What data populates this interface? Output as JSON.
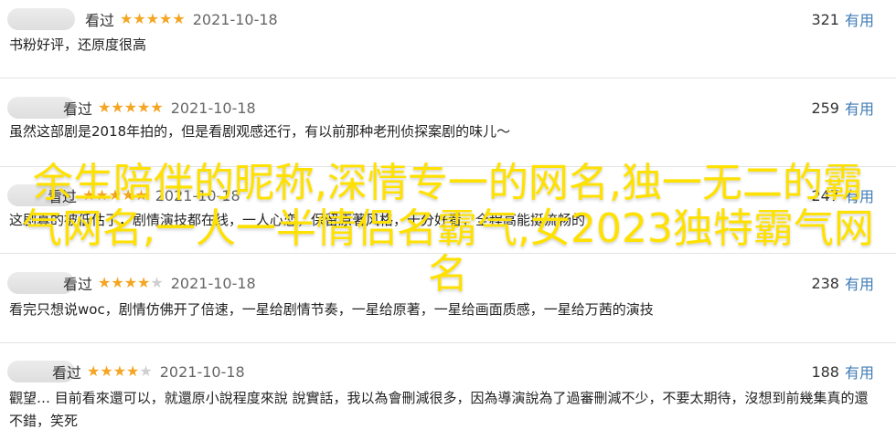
{
  "reviews": [
    {
      "status": "看过",
      "rating": 5,
      "date": "2021-10-18",
      "count": "321",
      "useful": "有用",
      "comment": "书粉好评，还原度很高"
    },
    {
      "status": "看过",
      "rating": 5,
      "date": "2021-10-18",
      "count": "259",
      "useful": "有用",
      "comment": "虽然这部剧是2018年拍的，但是看剧观感还行，有以前那种老刑侦探案剧的味儿～"
    },
    {
      "status": "看过",
      "rating": 5,
      "date": "2021-10-18",
      "count": "247",
      "useful": "有用",
      "comment": "这剧真的被低估了，剧情演技都在线，一人心恋，保留原著风格，十分好看，全程高能挺流畅的"
    },
    {
      "status": "看过",
      "rating": 4,
      "date": "2021-10-18",
      "count": "238",
      "useful": "有用",
      "comment": "看完只想说woc，剧情仿佛开了倍速，一星给剧情节奏，一星给原著，一星给画面质感，一星给万茜的演技"
    },
    {
      "status": "看过",
      "rating": 4,
      "date": "2021-10-18",
      "count": "188",
      "useful": "有用",
      "comment": "觀望… 目前看來還可以，就還原小說程度來說 說實話，我以為會刪減很多，因為導演說為了過審刪減不少，不要太期待，沒想到前幾集真的還不錯，笑死"
    }
  ],
  "overlay_title": "余生陪伴的昵称,深情专一的网名,独一无二的霸气网名,一人一半情侣名霸气,女2023独特霸气网名",
  "colors": {
    "star_on": "#f4a623",
    "star_off": "#cfcfcf",
    "useful_link": "#3f7bb6",
    "overlay_text": "#ffe100"
  }
}
